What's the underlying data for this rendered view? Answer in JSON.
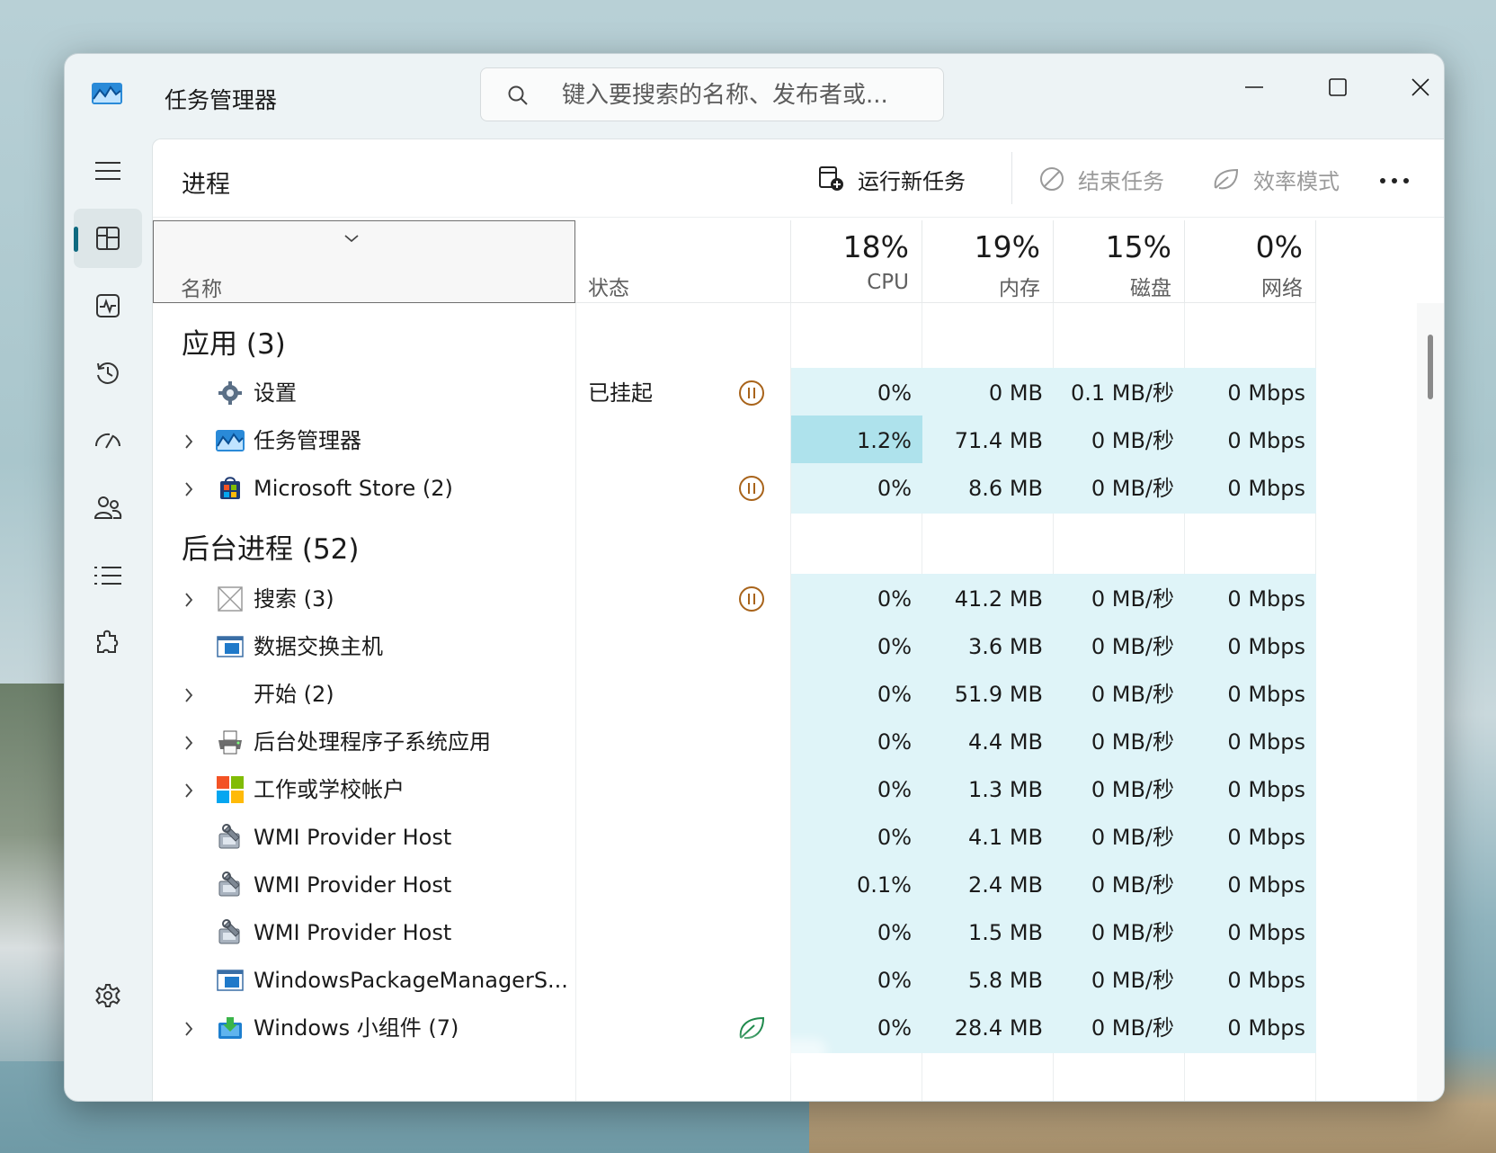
{
  "titlebar": {
    "app_title": "任务管理器",
    "search_placeholder": "键入要搜索的名称、发布者或..."
  },
  "page": {
    "title": "进程",
    "commands": {
      "run_new_task": "运行新任务",
      "end_task": "结束任务",
      "efficiency_mode": "效率模式"
    }
  },
  "columns": {
    "name": "名称",
    "status": "状态",
    "cpu": {
      "percent": "18%",
      "label": "CPU"
    },
    "memory": {
      "percent": "19%",
      "label": "内存"
    },
    "disk": {
      "percent": "15%",
      "label": "磁盘"
    },
    "network": {
      "percent": "0%",
      "label": "网络"
    }
  },
  "groups": {
    "apps": "应用 (3)",
    "background": "后台进程 (52)"
  },
  "apps": [
    {
      "name": "设置",
      "icon": "gear-icon",
      "expandable": false,
      "status": "已挂起",
      "paused": true,
      "efficiency": false,
      "cpu": "0%",
      "mem": "0 MB",
      "disk": "0.1 MB/秒",
      "net": "0 Mbps"
    },
    {
      "name": "任务管理器",
      "icon": "task-manager-icon",
      "expandable": true,
      "status": "",
      "paused": false,
      "efficiency": false,
      "cpu": "1.2%",
      "mem": "71.4 MB",
      "disk": "0 MB/秒",
      "net": "0 Mbps",
      "hot": true
    },
    {
      "name": "Microsoft Store (2)",
      "icon": "store-icon",
      "expandable": true,
      "status": "",
      "paused": true,
      "efficiency": false,
      "cpu": "0%",
      "mem": "8.6 MB",
      "disk": "0 MB/秒",
      "net": "0 Mbps"
    }
  ],
  "background": [
    {
      "name": "搜索 (3)",
      "icon": "search-placeholder-icon",
      "expandable": true,
      "paused": true,
      "efficiency": false,
      "cpu": "0%",
      "mem": "41.2 MB",
      "disk": "0 MB/秒",
      "net": "0 Mbps"
    },
    {
      "name": "数据交换主机",
      "icon": "window-app-icon",
      "expandable": false,
      "paused": false,
      "efficiency": false,
      "cpu": "0%",
      "mem": "3.6 MB",
      "disk": "0 MB/秒",
      "net": "0 Mbps"
    },
    {
      "name": "开始 (2)",
      "icon": "",
      "expandable": true,
      "paused": false,
      "efficiency": false,
      "cpu": "0%",
      "mem": "51.9 MB",
      "disk": "0 MB/秒",
      "net": "0 Mbps"
    },
    {
      "name": "后台处理程序子系统应用",
      "icon": "printer-icon",
      "expandable": true,
      "paused": false,
      "efficiency": false,
      "cpu": "0%",
      "mem": "4.4 MB",
      "disk": "0 MB/秒",
      "net": "0 Mbps"
    },
    {
      "name": "工作或学校帐户",
      "icon": "microsoft-logo-icon",
      "expandable": true,
      "paused": false,
      "efficiency": false,
      "cpu": "0%",
      "mem": "1.3 MB",
      "disk": "0 MB/秒",
      "net": "0 Mbps"
    },
    {
      "name": "WMI Provider Host",
      "icon": "wmi-icon",
      "expandable": false,
      "paused": false,
      "efficiency": false,
      "cpu": "0%",
      "mem": "4.1 MB",
      "disk": "0 MB/秒",
      "net": "0 Mbps"
    },
    {
      "name": "WMI Provider Host",
      "icon": "wmi-icon",
      "expandable": false,
      "paused": false,
      "efficiency": false,
      "cpu": "0.1%",
      "mem": "2.4 MB",
      "disk": "0 MB/秒",
      "net": "0 Mbps"
    },
    {
      "name": "WMI Provider Host",
      "icon": "wmi-icon",
      "expandable": false,
      "paused": false,
      "efficiency": false,
      "cpu": "0%",
      "mem": "1.5 MB",
      "disk": "0 MB/秒",
      "net": "0 Mbps"
    },
    {
      "name": "WindowsPackageManagerS...",
      "icon": "window-app-icon",
      "expandable": false,
      "paused": false,
      "efficiency": false,
      "cpu": "0%",
      "mem": "5.8 MB",
      "disk": "0 MB/秒",
      "net": "0 Mbps"
    },
    {
      "name": "Windows 小组件 (7)",
      "icon": "widgets-icon",
      "expandable": true,
      "paused": false,
      "efficiency": true,
      "cpu": "0%",
      "mem": "28.4 MB",
      "disk": "0 MB/秒",
      "net": "0 Mbps"
    }
  ],
  "colors": {
    "accent": "#0f6a80",
    "cell_bg": "#dff4f8",
    "cell_hot": "#aee2ec",
    "paused": "#a8631a",
    "efficiency": "#1f8a4c"
  }
}
